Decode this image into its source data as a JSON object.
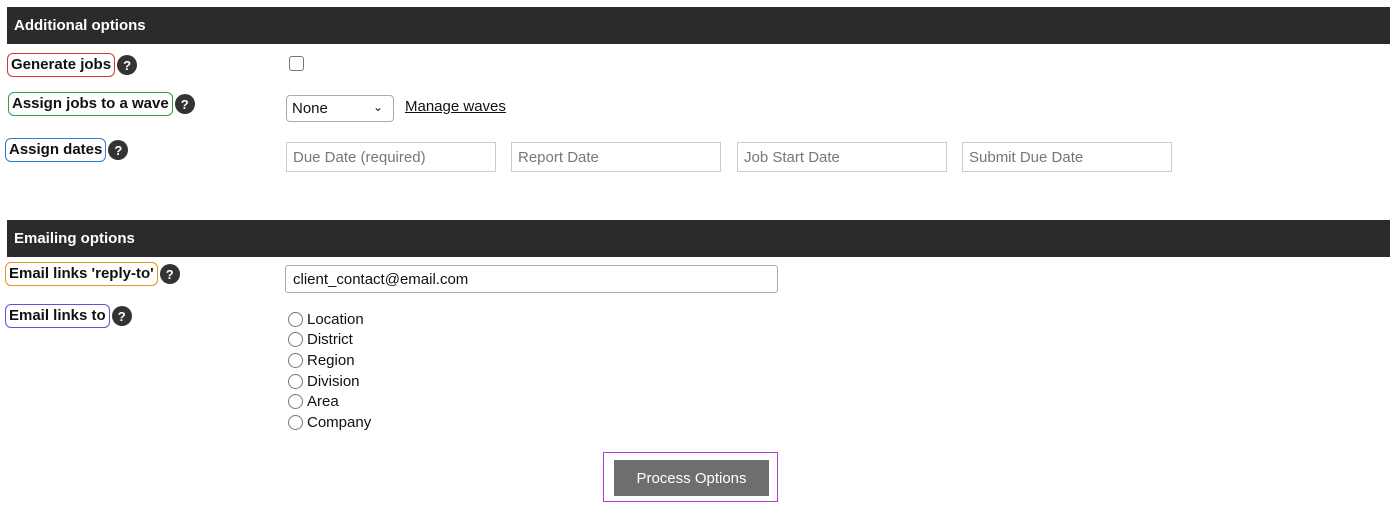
{
  "additional": {
    "header": "Additional options",
    "generate_jobs": {
      "label": "Generate jobs",
      "help": "?",
      "color": "#d93636"
    },
    "assign_wave": {
      "label": "Assign jobs to a wave",
      "help": "?",
      "color": "#2e9e47",
      "select_value": "None",
      "link": "Manage waves"
    },
    "assign_dates": {
      "label": "Assign dates",
      "help": "?",
      "color": "#2d7bd3",
      "placeholders": [
        "Due Date (required)",
        "Report Date",
        "Job Start Date",
        "Submit Due Date"
      ]
    }
  },
  "emailing": {
    "header": "Emailing options",
    "reply_to": {
      "label": "Email links 'reply-to'",
      "help": "?",
      "color": "#e8961e",
      "value": "client_contact@email.com"
    },
    "links_to": {
      "label": "Email links to",
      "help": "?",
      "color": "#6a4fd3",
      "options": [
        "Location",
        "District",
        "Region",
        "Division",
        "Area",
        "Company"
      ]
    }
  },
  "process_button": {
    "label": "Process Options",
    "outline_color": "#b23dd1"
  }
}
